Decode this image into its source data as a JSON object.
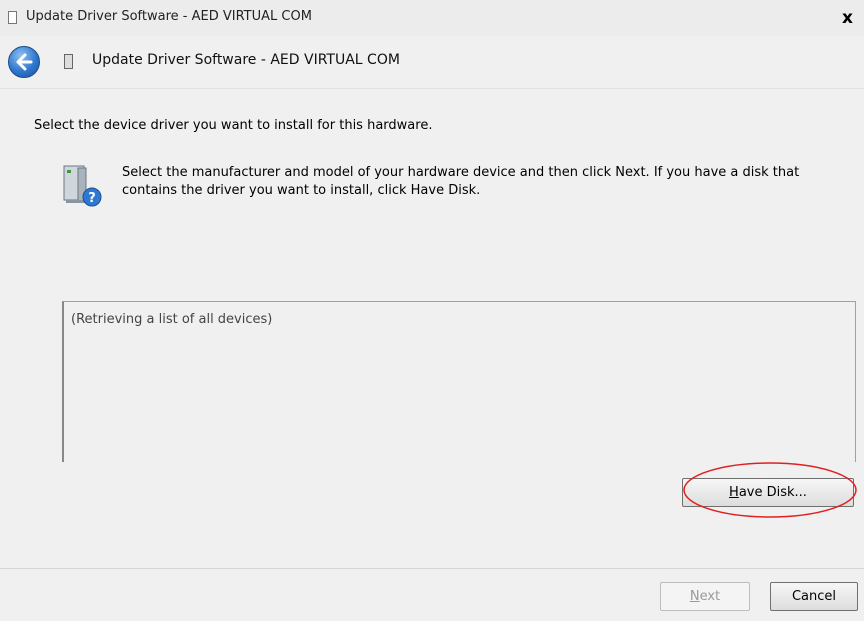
{
  "window": {
    "title": "Update Driver Software - AED VIRTUAL COM",
    "close_glyph": "x"
  },
  "header": {
    "back_icon": "back-arrow-icon",
    "title": "Update Driver Software - AED VIRTUAL COM"
  },
  "main": {
    "instruction": "Select the device driver you want to install for this hardware.",
    "device_icon": "hardware-question-icon",
    "description": "Select the manufacturer and model of your hardware device and then click Next. If you have a disk that contains the driver you want to install, click Have Disk.",
    "list_placeholder": "(Retrieving a list of all devices)",
    "have_disk": {
      "accel": "H",
      "rest": "ave Disk..."
    }
  },
  "footer": {
    "next": {
      "accel": "N",
      "rest": "ext"
    },
    "cancel_label": "Cancel"
  },
  "colors": {
    "background": "#f0f0f0",
    "highlight_ellipse": "#e02020",
    "back_button": "#2f78d0"
  }
}
